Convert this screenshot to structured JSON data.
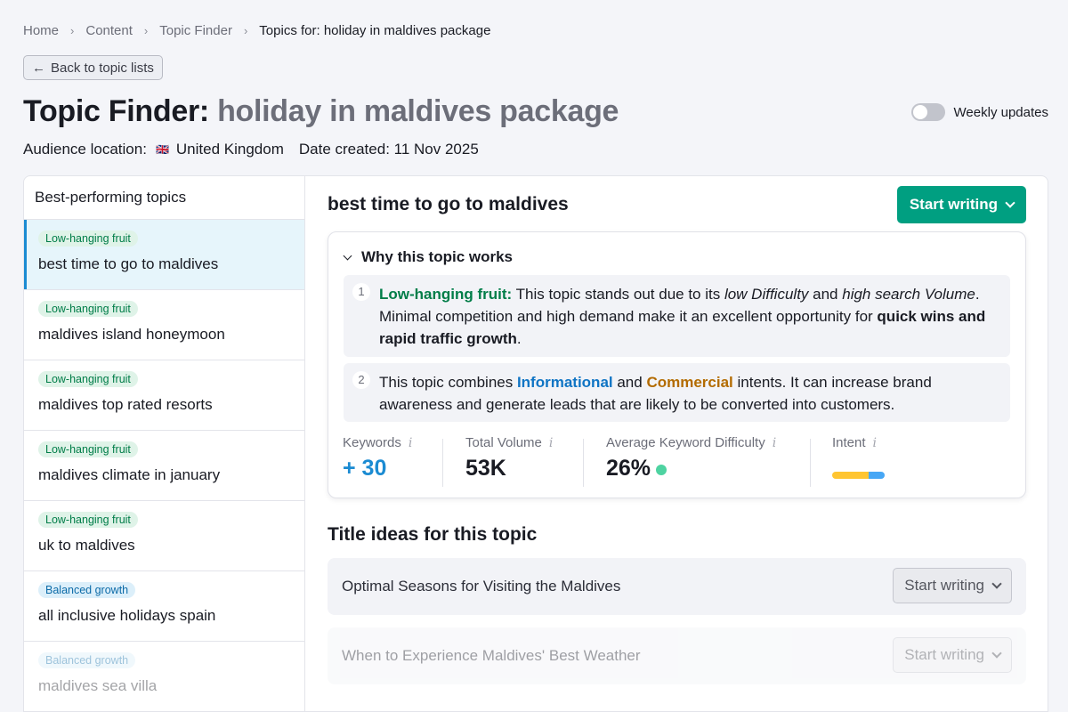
{
  "breadcrumb": [
    "Home",
    "Content",
    "Topic Finder",
    "Topics for: holiday in maldives package"
  ],
  "back_label": "Back to topic lists",
  "title_prefix": "Topic Finder:",
  "title_query": "holiday in maldives package",
  "weekly_label": "Weekly updates",
  "weekly_on": false,
  "audience_label": "Audience location:",
  "audience_flag": "🇬🇧",
  "audience_value": "United Kingdom",
  "date_label": "Date created: 11 Nov 2025",
  "sidebar": {
    "heading": "Best-performing topics",
    "items": [
      {
        "badge": "Low-hanging fruit",
        "name": "best time to go to maldives"
      },
      {
        "badge": "Low-hanging fruit",
        "name": "maldives island honeymoon"
      },
      {
        "badge": "Low-hanging fruit",
        "name": "maldives top rated resorts"
      },
      {
        "badge": "Low-hanging fruit",
        "name": "maldives climate in january"
      },
      {
        "badge": "Low-hanging fruit",
        "name": "uk to maldives"
      },
      {
        "badge": "Balanced growth",
        "name": "all inclusive holidays spain"
      },
      {
        "badge": "Balanced growth",
        "name": "maldives sea villa"
      }
    ]
  },
  "selected_topic": "best time to go to maldives",
  "start_writing": "Start writing",
  "why": {
    "heading": "Why this topic works",
    "r1": {
      "num": "1",
      "label": "Low-hanging fruit:",
      "t1": " This topic stands out due to its ",
      "e1": "low Difficulty",
      "t2": " and ",
      "e2": "high search Volume",
      "t3": ". Minimal competition and high demand make it an excellent opportunity for ",
      "b1": "quick wins and rapid traffic growth",
      "t4": "."
    },
    "r2": {
      "num": "2",
      "t1": "This topic combines ",
      "info": "Informational",
      "t2": " and ",
      "com": "Commercial",
      "t3": " intents. It can increase brand awareness and generate leads that are likely to be converted into customers."
    }
  },
  "stats": {
    "keywords_label": "Keywords",
    "keywords_value": "+ 30",
    "volume_label": "Total Volume",
    "volume_value": "53K",
    "difficulty_label": "Average Keyword Difficulty",
    "difficulty_value": "26%",
    "intent_label": "Intent",
    "info_glyph": "i",
    "intent_mix": {
      "commercial": 0.7,
      "informational": 0.3
    },
    "colors": {
      "commercial": "#ffc531",
      "informational": "#47a7f5",
      "difficulty_dot": "#4ed3a1"
    }
  },
  "titles_heading": "Title ideas for this topic",
  "titles": [
    "Optimal Seasons for Visiting the Maldives",
    "When to Experience Maldives' Best Weather"
  ],
  "icons": {
    "back": "←",
    "separator": "›"
  }
}
